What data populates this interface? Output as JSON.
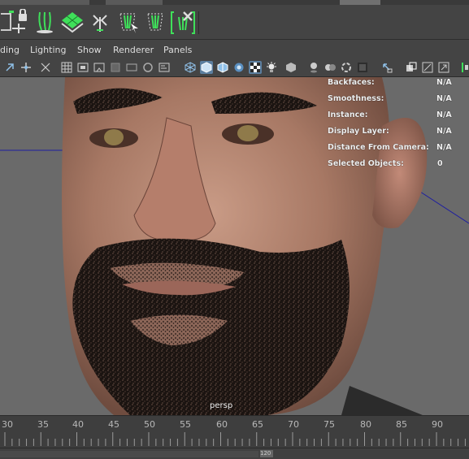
{
  "menu": {
    "items": [
      "ding",
      "Lighting",
      "Show",
      "Renderer",
      "Panels"
    ]
  },
  "shelf": {
    "icons": [
      "lock-move-icon",
      "hair-brush-icon",
      "grid-plane-icon",
      "rig-pose-icon",
      "hair-select-icon",
      "hair-curve-icon",
      "delete-hair-icon"
    ]
  },
  "toolbar": {
    "icons": [
      "camera-select-icon",
      "camera-move-icon",
      "frame-icon",
      "grid-icon",
      "film-gate-icon",
      "safe-frame-icon",
      "square-icon",
      "resolution-gate-icon",
      "circle-icon",
      "hud-icon",
      "wireframe-icon",
      "smooth-shade-icon",
      "wireframe-on-shaded-icon",
      "textured-icon",
      "lights-icon",
      "shadows-icon",
      "ambient-occlusion-icon",
      "motion-blur-icon",
      "anti-alias-icon",
      "depth-of-field-icon",
      "isolate-icon",
      "xray-icon",
      "xray-joints-icon",
      "component-xray-icon",
      "maya-icon"
    ]
  },
  "viewport": {
    "camera_label": "persp",
    "hud": [
      {
        "label": "Backfaces:",
        "value": "N/A"
      },
      {
        "label": "Smoothness:",
        "value": "N/A"
      },
      {
        "label": "Instance:",
        "value": "N/A"
      },
      {
        "label": "Display Layer:",
        "value": "N/A"
      },
      {
        "label": "Distance From Camera:",
        "value": "N/A"
      },
      {
        "label": "Selected Objects:",
        "value": "0"
      }
    ]
  },
  "timeline": {
    "ticks": [
      "30",
      "35",
      "40",
      "45",
      "50",
      "55",
      "60",
      "65",
      "70",
      "75",
      "80",
      "85",
      "90"
    ]
  },
  "range": {
    "end_value": "120"
  },
  "colors": {
    "accent_green": "#3fe05a",
    "active_blue": "#5c7fa0",
    "hud_text": "#f0f0f0"
  }
}
